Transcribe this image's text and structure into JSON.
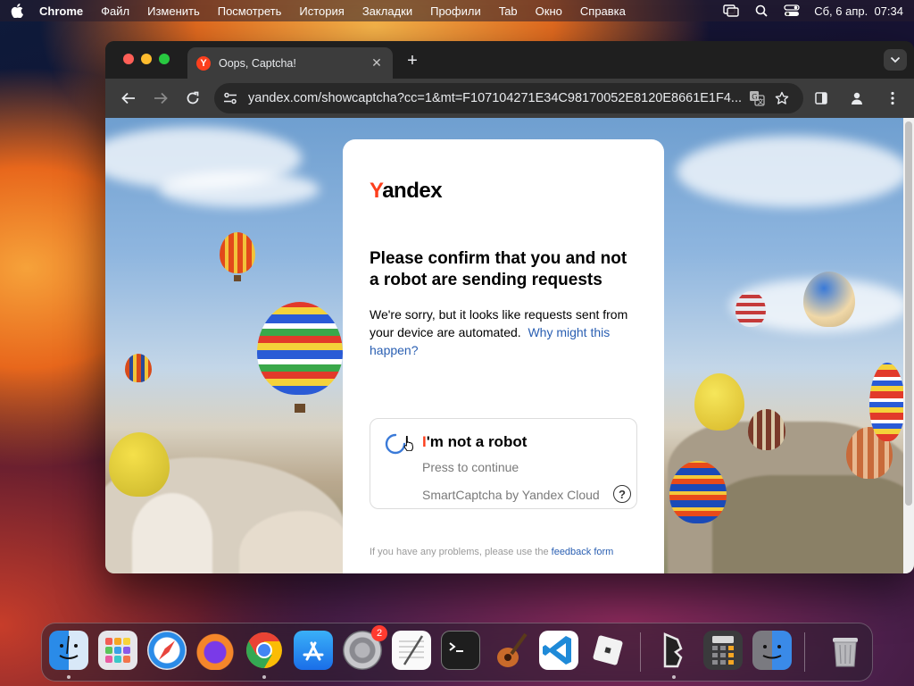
{
  "menubar": {
    "app_name": "Chrome",
    "items": [
      "Файл",
      "Изменить",
      "Посмотреть",
      "История",
      "Закладки",
      "Профили",
      "Tab",
      "Окно",
      "Справка"
    ],
    "datetime": "Сб, 6 апр.  07:34"
  },
  "browser": {
    "tab": {
      "title": "Oops, Captcha!",
      "favicon_letter": "Y"
    },
    "url": "yandex.com/showcaptcha?cc=1&mt=F107104271E34C98170052E8120E8661E1F4..."
  },
  "page": {
    "logo": {
      "first": "Y",
      "rest": "andex"
    },
    "headline": "Please confirm that you and not a robot are sending requests",
    "description": "We're sorry, but it looks like requests sent from your device are automated.",
    "description_link": "Why might this happen?",
    "captcha": {
      "title_first": "I",
      "title_rest": "'m not a robot",
      "subtitle": "Press to continue",
      "brand": "SmartCaptcha by Yandex Cloud",
      "help": "?"
    },
    "footer_text": "If you have any problems, please use the",
    "footer_link": "feedback form"
  },
  "dock": {
    "items": [
      "finder",
      "launchpad",
      "safari",
      "firefox",
      "chrome",
      "app-store",
      "system-settings",
      "textedit",
      "terminal",
      "garageband",
      "vscode",
      "roblox",
      "bluestacks",
      "calculator",
      "migration-assistant",
      "trash"
    ],
    "settings_badge": "2"
  },
  "colors": {
    "yandex_red": "#fc3f1d",
    "link_blue": "#2a5fb2"
  }
}
